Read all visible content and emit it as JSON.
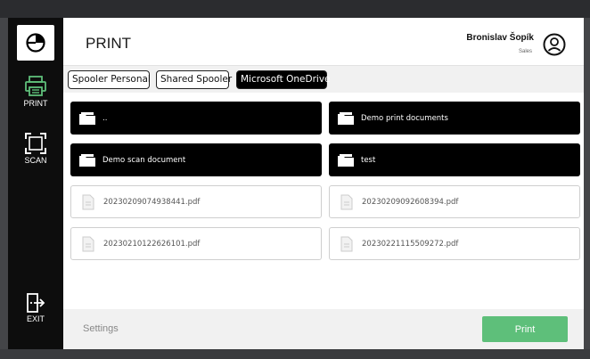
{
  "header": {
    "title": "PRINT"
  },
  "user": {
    "name": "Bronislav Šopík",
    "role": "Sales"
  },
  "nav": [
    {
      "label": "PRINT"
    },
    {
      "label": "SCAN"
    },
    {
      "label": "EXIT"
    }
  ],
  "tabs": [
    {
      "label": "Spooler Personal",
      "active": false
    },
    {
      "label": "Shared Spooler",
      "active": false
    },
    {
      "label": "Microsoft OneDrive",
      "active": true
    }
  ],
  "folders": [
    {
      "label": ".."
    },
    {
      "label": "Demo print documents"
    },
    {
      "label": "Demo scan document"
    },
    {
      "label": "test"
    }
  ],
  "files": [
    {
      "label": "20230209074938441.pdf"
    },
    {
      "label": "20230209092608394.pdf"
    },
    {
      "label": "20230210122626101.pdf"
    },
    {
      "label": "20230221115509272.pdf"
    }
  ],
  "footer": {
    "settings_label": "Settings",
    "print_label": "Print"
  },
  "colors": {
    "accent": "#5ebf7a",
    "sidebar": "#0d0d0d",
    "nav_icon": "#5ebf7a"
  }
}
